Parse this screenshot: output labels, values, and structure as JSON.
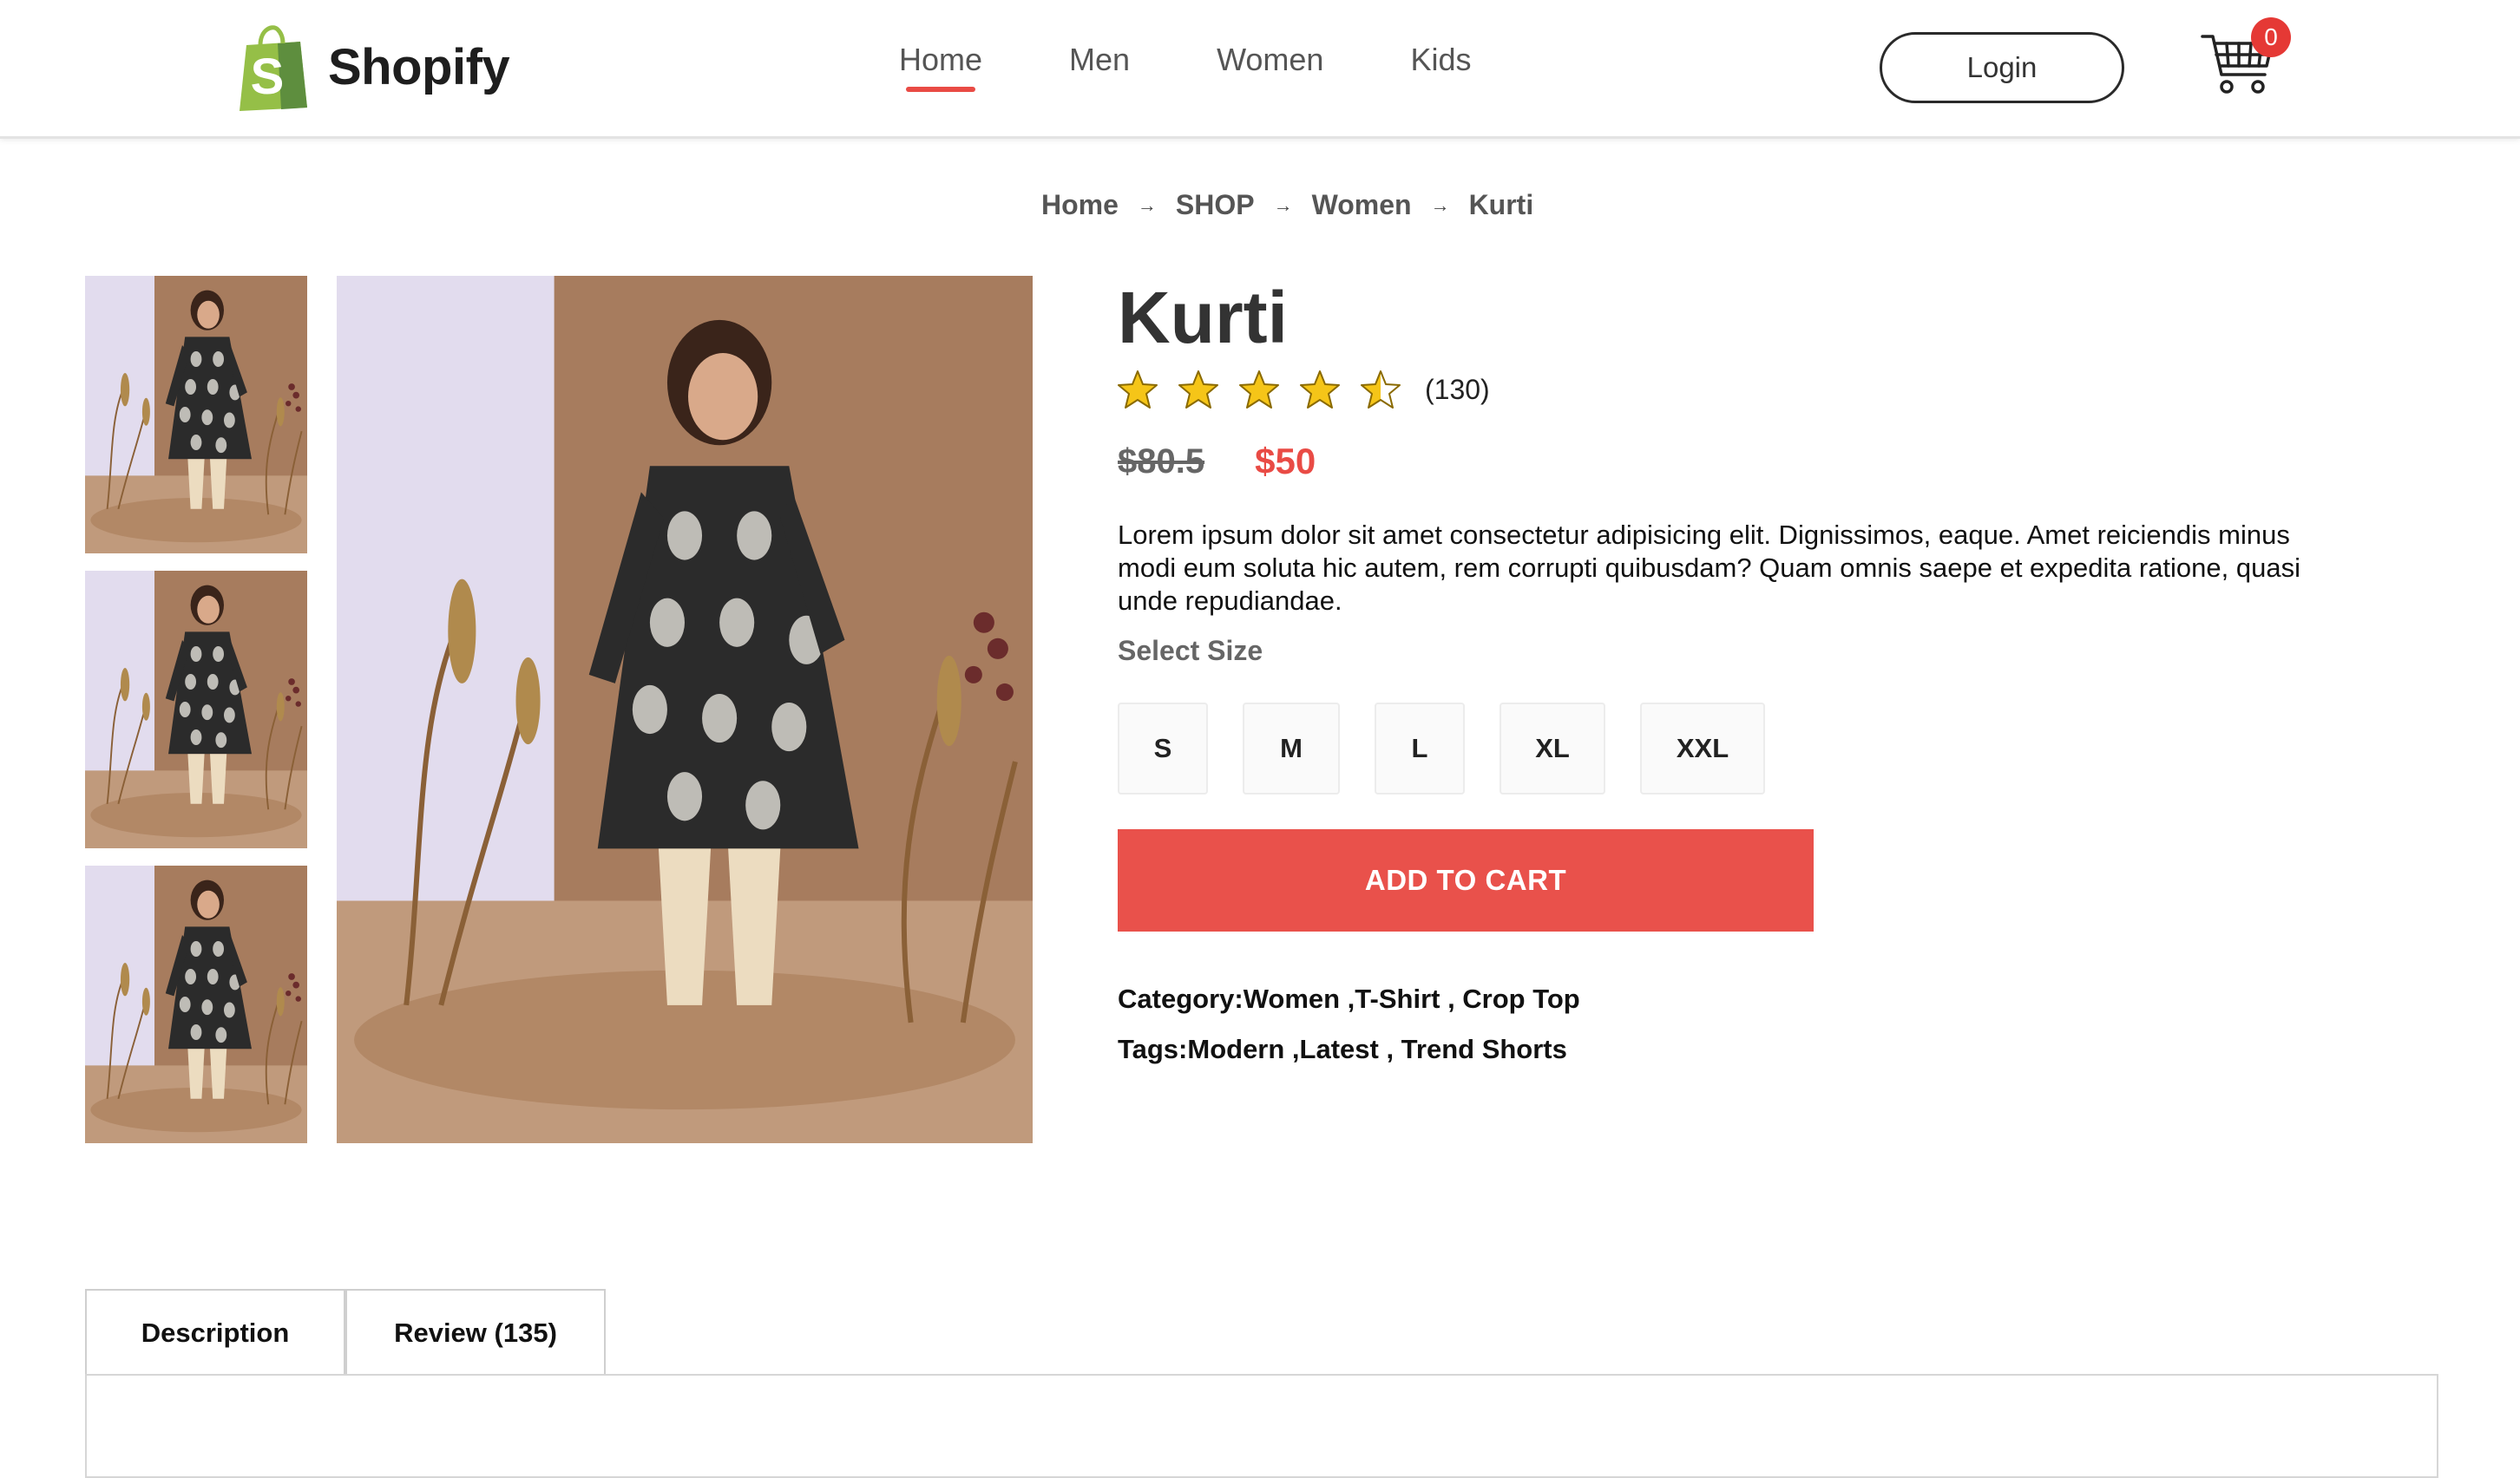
{
  "brand": {
    "name": "Shopify",
    "logo_letter": "S",
    "logo_color": "#95bf47"
  },
  "nav": {
    "links": [
      {
        "label": "Home",
        "active": true
      },
      {
        "label": "Men",
        "active": false
      },
      {
        "label": "Women",
        "active": false
      },
      {
        "label": "Kids",
        "active": false
      }
    ],
    "login_label": "Login",
    "cart_count": "0"
  },
  "breadcrumb": [
    "Home",
    "SHOP",
    "Women",
    "Kurti"
  ],
  "product": {
    "title": "Kurti",
    "rating": 4.5,
    "rating_max": 5,
    "rating_count": "(130)",
    "old_price": "$80.5",
    "price": "$50",
    "description": "Lorem ipsum dolor sit amet consectetur adipisicing elit. Dignissimos, eaque. Amet reiciendis minus modi eum soluta hic autem, rem corrupti quibusdam? Quam omnis saepe et expedita ratione, quasi unde repudiandae.",
    "size_label": "Select Size",
    "sizes": [
      "S",
      "M",
      "L",
      "XL",
      "XXL"
    ],
    "add_to_cart": "ADD TO CART",
    "category": "Category:Women ,T-Shirt , Crop Top",
    "tags": "Tags:Modern ,Latest , Trend Shorts"
  },
  "tabs": [
    {
      "label": "Description"
    },
    {
      "label": "Review (135)"
    }
  ],
  "colors": {
    "accent": "#e94b45",
    "star": "#f5c518"
  },
  "icons": {
    "cart": "shopping-cart-icon",
    "star": "star-icon",
    "arrow": "arrow-right-icon"
  }
}
